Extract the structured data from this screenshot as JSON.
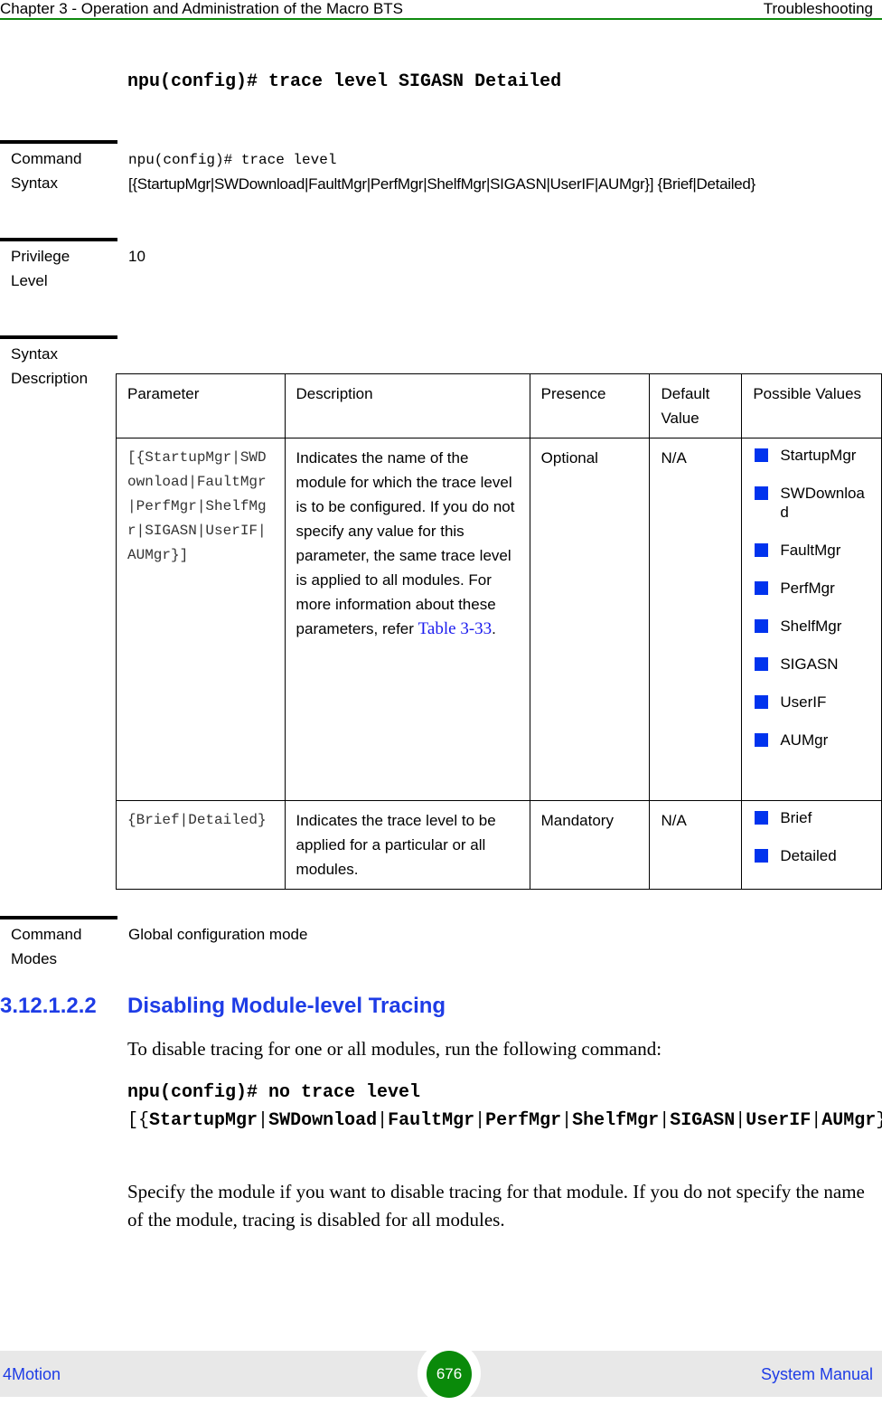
{
  "header": {
    "chapter": "Chapter 3 - Operation and Administration of the Macro BTS",
    "section": "Troubleshooting"
  },
  "example_command": "npu(config)# trace level SIGASN Detailed",
  "command_syntax": {
    "label_line1": "Command",
    "label_line2": "Syntax",
    "line1": "npu(config)# trace level",
    "line2": "[{StartupMgr|SWDownload|FaultMgr|PerfMgr|ShelfMgr|SIGASN|UserIF|AUMgr}] {Brief|Detailed}"
  },
  "privilege_level": {
    "label_line1": "Privilege",
    "label_line2": "Level",
    "value": "10"
  },
  "syntax_description": {
    "label_line1": "Syntax",
    "label_line2": "Description",
    "table": {
      "headers": [
        "Parameter",
        "Description",
        "Presence",
        "Default Value",
        "Possible Values"
      ],
      "rows": [
        {
          "parameter": "[{StartupMgr|SWDownload|FaultMgr|PerfMgr|ShelfMgr|SIGASN|UserIF|AUMgr}]",
          "description": "Indicates the name of the module for which the trace level is to be configured. If you do not specify any value for this parameter, the same trace level is applied to all modules. For more information about these parameters, refer",
          "description_link": "Table 3-33",
          "description_suffix": ".",
          "presence": "Optional",
          "default": "N/A",
          "values": [
            "StartupMgr",
            "SWDownload",
            "FaultMgr",
            "PerfMgr",
            "ShelfMgr",
            "SIGASN",
            "UserIF",
            "AUMgr"
          ]
        },
        {
          "parameter": "{Brief|Detailed}",
          "description": "Indicates the trace level to be applied for a particular or all modules.",
          "presence": "Mandatory",
          "default": "N/A",
          "values": [
            "Brief",
            "Detailed"
          ]
        }
      ]
    }
  },
  "command_modes": {
    "label_line1": "Command",
    "label_line2": "Modes",
    "value": "Global configuration mode"
  },
  "section_heading": {
    "number": "3.12.1.2.2",
    "title": "Disabling Module-level Tracing"
  },
  "intro_text": "To disable tracing for one or all modules, run the following command:",
  "disable_command": {
    "prefix": "npu(config)# no trace level",
    "modules": [
      "StartupMgr",
      "SWDownload",
      "FaultMgr",
      "PerfMgr",
      "ShelfMgr",
      "SIGASN",
      "UserIF",
      "AUMgr"
    ]
  },
  "closing_text": "Specify the module if you want to disable tracing for that module. If you do not specify the name of the module, tracing is disabled for all modules.",
  "footer": {
    "product": "4Motion",
    "page_number": "676",
    "doc_title": "System Manual"
  },
  "colors": {
    "accent_green": "#0a8a0a",
    "heading_blue": "#1e3ce6",
    "bullet_blue": "#0033ee",
    "footer_bg": "#e8e8e8"
  }
}
